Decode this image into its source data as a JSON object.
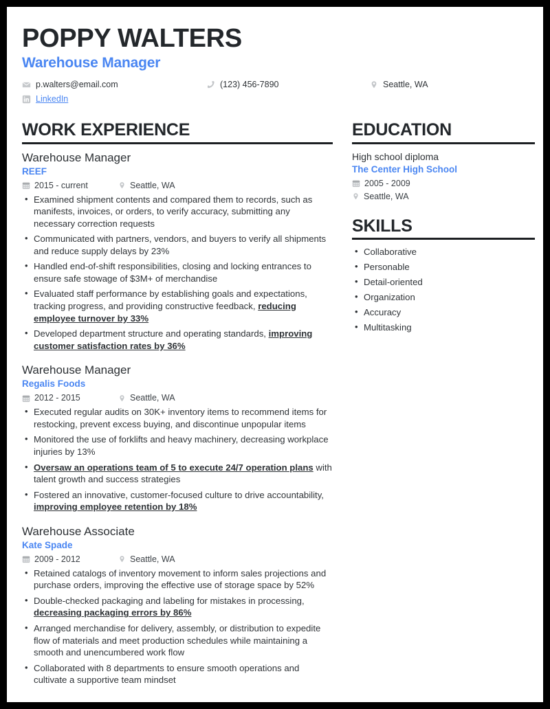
{
  "header": {
    "name": "POPPY WALTERS",
    "role": "Warehouse Manager",
    "contact": {
      "email": "p.walters@email.com",
      "phone": "(123) 456-7890",
      "location": "Seattle, WA",
      "linkedin": "LinkedIn",
      "email_icon": "envelope-icon",
      "phone_icon": "phone-icon",
      "location_icon": "map-pin-icon",
      "linkedin_icon": "linkedin-icon"
    }
  },
  "colors": {
    "accent_blue": "#4a86f2",
    "text_dark": "#2f3337",
    "heading_dark": "#23272b",
    "icon_gray": "#c3c6c9",
    "page_border": "#000000"
  },
  "sections": {
    "work_experience_title": "WORK EXPERIENCE",
    "education_title": "EDUCATION",
    "skills_title": "SKILLS"
  },
  "work_experience": [
    {
      "title": "Warehouse Manager",
      "company": "REEF",
      "dates": "2015 - current",
      "location": "Seattle, WA",
      "bullets": [
        [
          {
            "text": "Examined shipment contents and compared them to records, such as manifests, invoices, or orders, to verify accuracy, submitting any necessary correction requests",
            "emphasis": false
          }
        ],
        [
          {
            "text": "Communicated with partners, vendors, and buyers to verify all shipments and reduce supply delays by 23%",
            "emphasis": false
          }
        ],
        [
          {
            "text": "Handled end-of-shift responsibilities, closing and locking entrances to ensure safe stowage of $3M+ of merchandise",
            "emphasis": false
          }
        ],
        [
          {
            "text": "Evaluated staff performance by establishing goals and expectations, tracking progress, and providing constructive feedback, ",
            "emphasis": false
          },
          {
            "text": "reducing employee turnover by 33%",
            "emphasis": true
          }
        ],
        [
          {
            "text": "Developed department structure and operating standards, ",
            "emphasis": false
          },
          {
            "text": "improving customer satisfaction rates by 36%",
            "emphasis": true
          }
        ]
      ]
    },
    {
      "title": "Warehouse Manager",
      "company": "Regalis Foods",
      "dates": "2012 - 2015",
      "location": "Seattle, WA",
      "bullets": [
        [
          {
            "text": "Executed regular audits on 30K+ inventory items to recommend items for restocking, prevent excess buying, and discontinue unpopular items",
            "emphasis": false
          }
        ],
        [
          {
            "text": "Monitored the use of forklifts and heavy machinery, decreasing workplace injuries by 13%",
            "emphasis": false
          }
        ],
        [
          {
            "text": "Oversaw an operations team of 5 to execute 24/7 operation plans",
            "emphasis": true
          },
          {
            "text": " with talent growth and success strategies",
            "emphasis": false
          }
        ],
        [
          {
            "text": "Fostered an innovative, customer-focused culture to drive accountability, ",
            "emphasis": false
          },
          {
            "text": "improving employee retention by 18%",
            "emphasis": true
          }
        ]
      ]
    },
    {
      "title": "Warehouse Associate",
      "company": "Kate Spade",
      "dates": "2009 - 2012",
      "location": "Seattle, WA",
      "bullets": [
        [
          {
            "text": "Retained catalogs of inventory movement to inform sales projections and purchase orders, improving the effective use of storage space by 52%",
            "emphasis": false
          }
        ],
        [
          {
            "text": "Double-checked packaging and labeling for mistakes in processing, ",
            "emphasis": false
          },
          {
            "text": "decreasing packaging errors by 86%",
            "emphasis": true
          }
        ],
        [
          {
            "text": "Arranged merchandise for delivery, assembly, or distribution to expedite flow of materials and meet production schedules while maintaining a smooth and unencumbered work flow",
            "emphasis": false
          }
        ],
        [
          {
            "text": "Collaborated with 8 departments to ensure smooth operations and cultivate a supportive team mindset",
            "emphasis": false
          }
        ]
      ]
    }
  ],
  "education": [
    {
      "degree": "High school diploma",
      "school": "The Center High School",
      "dates": "2005 - 2009",
      "location": "Seattle, WA"
    }
  ],
  "skills": [
    "Collaborative",
    "Personable",
    "Detail-oriented",
    "Organization",
    "Accuracy",
    "Multitasking"
  ]
}
